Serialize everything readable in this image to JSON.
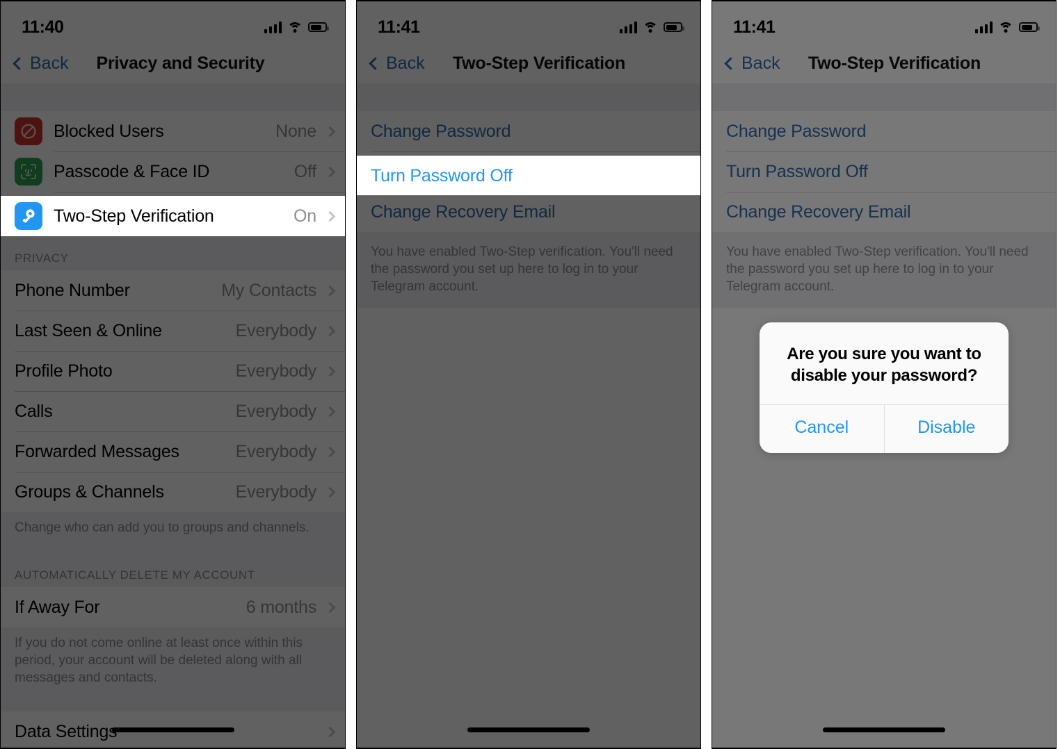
{
  "panels": [
    {
      "id": "privacy-and-security",
      "status": {
        "time": "11:40"
      },
      "nav": {
        "back_label": "Back",
        "title": "Privacy and Security"
      },
      "security_rows": [
        {
          "icon": "block-icon",
          "label": "Blocked Users",
          "value": "None"
        },
        {
          "icon": "face-id-icon",
          "label": "Passcode & Face ID",
          "value": "Off"
        },
        {
          "icon": "key-icon",
          "label": "Two-Step Verification",
          "value": "On",
          "highlighted": true
        }
      ],
      "privacy_header": "PRIVACY",
      "privacy_rows": [
        {
          "label": "Phone Number",
          "value": "My Contacts"
        },
        {
          "label": "Last Seen & Online",
          "value": "Everybody"
        },
        {
          "label": "Profile Photo",
          "value": "Everybody"
        },
        {
          "label": "Calls",
          "value": "Everybody"
        },
        {
          "label": "Forwarded Messages",
          "value": "Everybody"
        },
        {
          "label": "Groups & Channels",
          "value": "Everybody"
        }
      ],
      "privacy_footnote": "Change who can add you to groups and channels.",
      "delete_header": "AUTOMATICALLY DELETE MY ACCOUNT",
      "delete_rows": [
        {
          "label": "If Away For",
          "value": "6 months"
        }
      ],
      "delete_footnote": "If you do not come online at least once within this period, your account will be deleted along with all messages and contacts.",
      "last_rows": [
        {
          "label": "Data Settings",
          "value": ""
        }
      ]
    },
    {
      "id": "two-step-verification-highlighted",
      "status": {
        "time": "11:41"
      },
      "nav": {
        "back_label": "Back",
        "title": "Two-Step Verification"
      },
      "links": [
        {
          "label": "Change Password",
          "highlighted": false
        },
        {
          "label": "Turn Password Off",
          "highlighted": true
        },
        {
          "label": "Change Recovery Email",
          "highlighted": false
        }
      ],
      "footnote": "You have enabled Two-Step verification. You'll need the password you set up here to log in to your Telegram account."
    },
    {
      "id": "two-step-verification-alert",
      "status": {
        "time": "11:41"
      },
      "nav": {
        "back_label": "Back",
        "title": "Two-Step Verification"
      },
      "links": [
        {
          "label": "Change Password",
          "highlighted": false
        },
        {
          "label": "Turn Password Off",
          "highlighted": false
        },
        {
          "label": "Change Recovery Email",
          "highlighted": false
        }
      ],
      "footnote": "You have enabled Two-Step verification. You'll need the password you set up here to log in to your Telegram account.",
      "alert": {
        "title": "Are you sure you want to disable your password?",
        "cancel_label": "Cancel",
        "confirm_label": "Disable"
      }
    }
  ],
  "colors": {
    "accent_blue": "#2196f3",
    "link_blue": "#2f6aad",
    "icon_red": "#c9332e",
    "icon_green": "#2f9e4f",
    "icon_blue": "#2196f3",
    "group_bg": "#efeff4",
    "secondary_text": "#8e8e93"
  }
}
